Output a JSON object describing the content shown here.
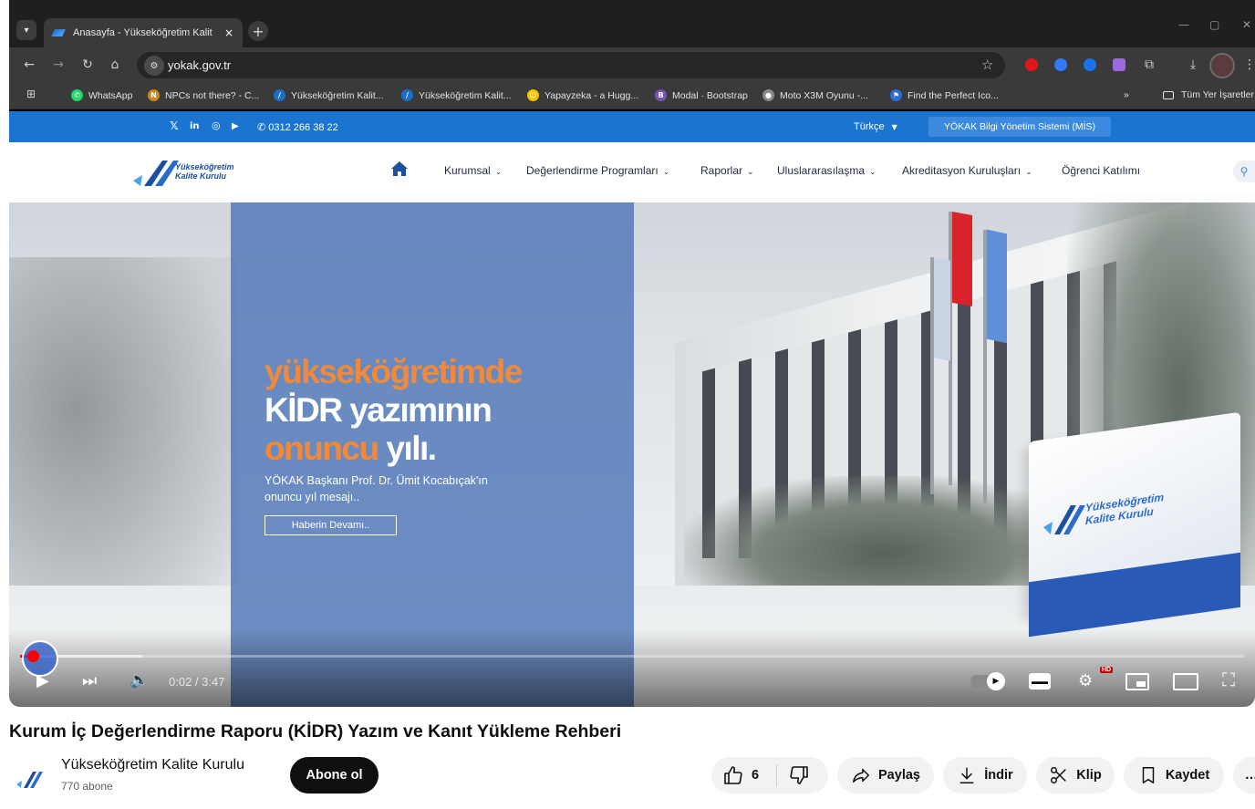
{
  "browser": {
    "tab_title": "Anasayfa - Yükseköğretim Kalit",
    "tab_close": "×",
    "new_tab": "+",
    "url": "yokak.gov.tr",
    "bookmarks": [
      {
        "label": "WhatsApp",
        "color": "#25d366",
        "glyph": "✆"
      },
      {
        "label": "NPCs not there? - C...",
        "color": "#c98a1a",
        "glyph": "N"
      },
      {
        "label": "Yükseköğretim Kalit...",
        "color": "#1c6dc8",
        "glyph": "/"
      },
      {
        "label": "Yükseköğretim Kalit...",
        "color": "#1c6dc8",
        "glyph": "/"
      },
      {
        "label": "Yapayzeka - a Hugg...",
        "color": "#f5c400",
        "glyph": "☺"
      },
      {
        "label": "Modal · Bootstrap",
        "color": "#7952b3",
        "glyph": "B"
      },
      {
        "label": "Moto X3M Oyunu -...",
        "color": "#8a8a8a",
        "glyph": "●"
      },
      {
        "label": "Find the Perfect Ico...",
        "color": "#2a6fd6",
        "glyph": "⚑"
      }
    ],
    "bookmarks_overflow": "»",
    "all_bookmarks": "Tüm Yer İşaretler"
  },
  "site": {
    "phone": "0312 266 38 22",
    "language": "Türkçe",
    "mis_label": "YÖKAK Bilgi Yönetim Sistemi (MİS)",
    "logo_line1": "Yükseköğretim",
    "logo_line2": "Kalite Kurulu",
    "nav": [
      "Kurumsal",
      "Değerlendirme Programları",
      "Raporlar",
      "Uluslararasılaşma",
      "Akreditasyon Kuruluşları",
      "Öğrenci Katılımı"
    ],
    "hero": {
      "line1": "yükseköğretimde",
      "line2": "KİDR yazımının",
      "line3_orange": "onuncu",
      "line3_white": "yılı.",
      "subtitle": "YÖKAK Başkanı Prof. Dr. Ümit Kocabıçak'ın onuncu yıl mesajı..",
      "button": "Haberin Devamı..",
      "sign_text_1": "Yükseköğretim",
      "sign_text_2": "Kalite Kurulu"
    }
  },
  "player": {
    "time": "0:02 / 3:47",
    "progress_fraction": 0.0088,
    "buffer_fraction": 0.1,
    "hd_badge": "HD"
  },
  "video": {
    "title": "Kurum İç Değerlendirme Raporu (KİDR) Yazım ve Kanıt Yükleme Rehberi",
    "channel": "Yükseköğretim Kalite Kurulu",
    "subscribers": "770 abone",
    "subscribe_label": "Abone ol",
    "like_count": "6",
    "share_label": "Paylaş",
    "download_label": "İndir",
    "clip_label": "Klip",
    "save_label": "Kaydet",
    "more_label": "…"
  },
  "colors": {
    "site_blue": "#1b75d0",
    "promo_orange": "#f08a3a",
    "progress_red": "#ff0000"
  }
}
